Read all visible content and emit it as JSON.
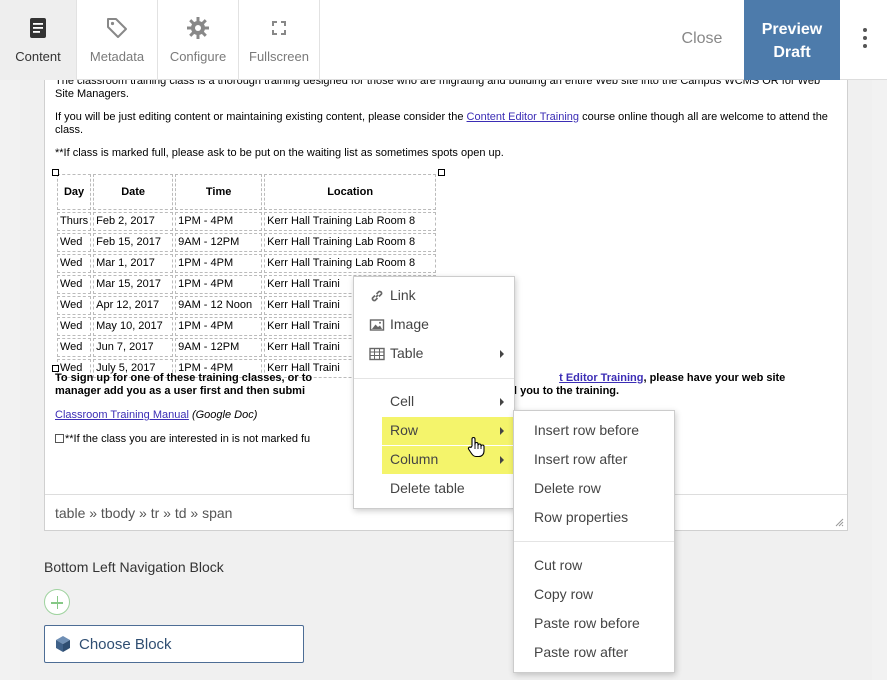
{
  "toolbar": {
    "tabs": [
      {
        "label": "Content",
        "icon": "document-icon"
      },
      {
        "label": "Metadata",
        "icon": "tag-icon"
      },
      {
        "label": "Configure",
        "icon": "gear-icon"
      },
      {
        "label": "Fullscreen",
        "icon": "fullscreen-icon"
      }
    ],
    "close_label": "Close",
    "preview_line1": "Preview",
    "preview_line2": "Draft",
    "accent": "#4d7bab"
  },
  "editor": {
    "para1": "The classroom training class is a thorough training designed for those who are migrating and building an entire Web site into the Campus WCMS OR for Web Site Managers.",
    "para2_pre": "If you will be just editing content or maintaining existing content, please consider the ",
    "para2_link": "Content Editor Training",
    "para2_post": " course online though all are welcome to attend the class.",
    "para3": "**If class is marked full, please ask to be put on the waiting list as sometimes spots open up.",
    "table": {
      "headers": [
        "Day",
        "Date",
        "Time",
        "Location"
      ],
      "rows": [
        [
          "Thurs",
          "Feb 2, 2017",
          "1PM - 4PM",
          "Kerr Hall Training Lab Room 8"
        ],
        [
          "Wed",
          "Feb 15, 2017",
          "9AM - 12PM",
          "Kerr Hall Training Lab Room 8"
        ],
        [
          "Wed",
          "Mar 1, 2017",
          "1PM - 4PM",
          "Kerr Hall Training Lab Room 8"
        ],
        [
          "Wed",
          "Mar 15, 2017",
          "1PM - 4PM",
          "Kerr Hall Traini"
        ],
        [
          "Wed",
          "Apr 12, 2017",
          "9AM - 12 Noon",
          "Kerr Hall Traini"
        ],
        [
          "Wed",
          "May 10, 2017",
          "1PM - 4PM",
          "Kerr Hall Traini"
        ],
        [
          "Wed",
          "Jun 7, 2017",
          "9AM - 12PM",
          "Kerr Hall Traini"
        ],
        [
          "Wed",
          "July 5, 2017",
          "1PM - 4PM",
          "Kerr Hall Traini"
        ]
      ]
    },
    "signup_line1_a": "To sign up for one of these training classes, or to",
    "signup_line1_link": "t Editor Training",
    "signup_line1_b": ", please have your web site",
    "signup_line2_a": "manager add you as a user first  and then submi",
    "signup_line2_b": "we'll add you to the training.",
    "manual_link": "Classroom Training Manual",
    "manual_note": "(Google Doc)",
    "not_full": "**If the class you are interested in is not marked fu",
    "breadcrumb": "table » tbody » tr » td » span"
  },
  "below": {
    "section_label": "Bottom Left Navigation Block",
    "choose_block_label": "Choose Block"
  },
  "context_menu": {
    "items": [
      {
        "label": "Link",
        "icon": "link-icon"
      },
      {
        "label": "Image",
        "icon": "image-icon"
      },
      {
        "label": "Table",
        "icon": "table-icon"
      },
      {
        "label": "Cell"
      },
      {
        "label": "Row"
      },
      {
        "label": "Column"
      },
      {
        "label": "Delete table"
      }
    ],
    "highlight": "#f4f46b"
  },
  "row_submenu": {
    "items": [
      "Insert row before",
      "Insert row after",
      "Delete row",
      "Row properties",
      "Cut row",
      "Copy row",
      "Paste row before",
      "Paste row after"
    ]
  }
}
